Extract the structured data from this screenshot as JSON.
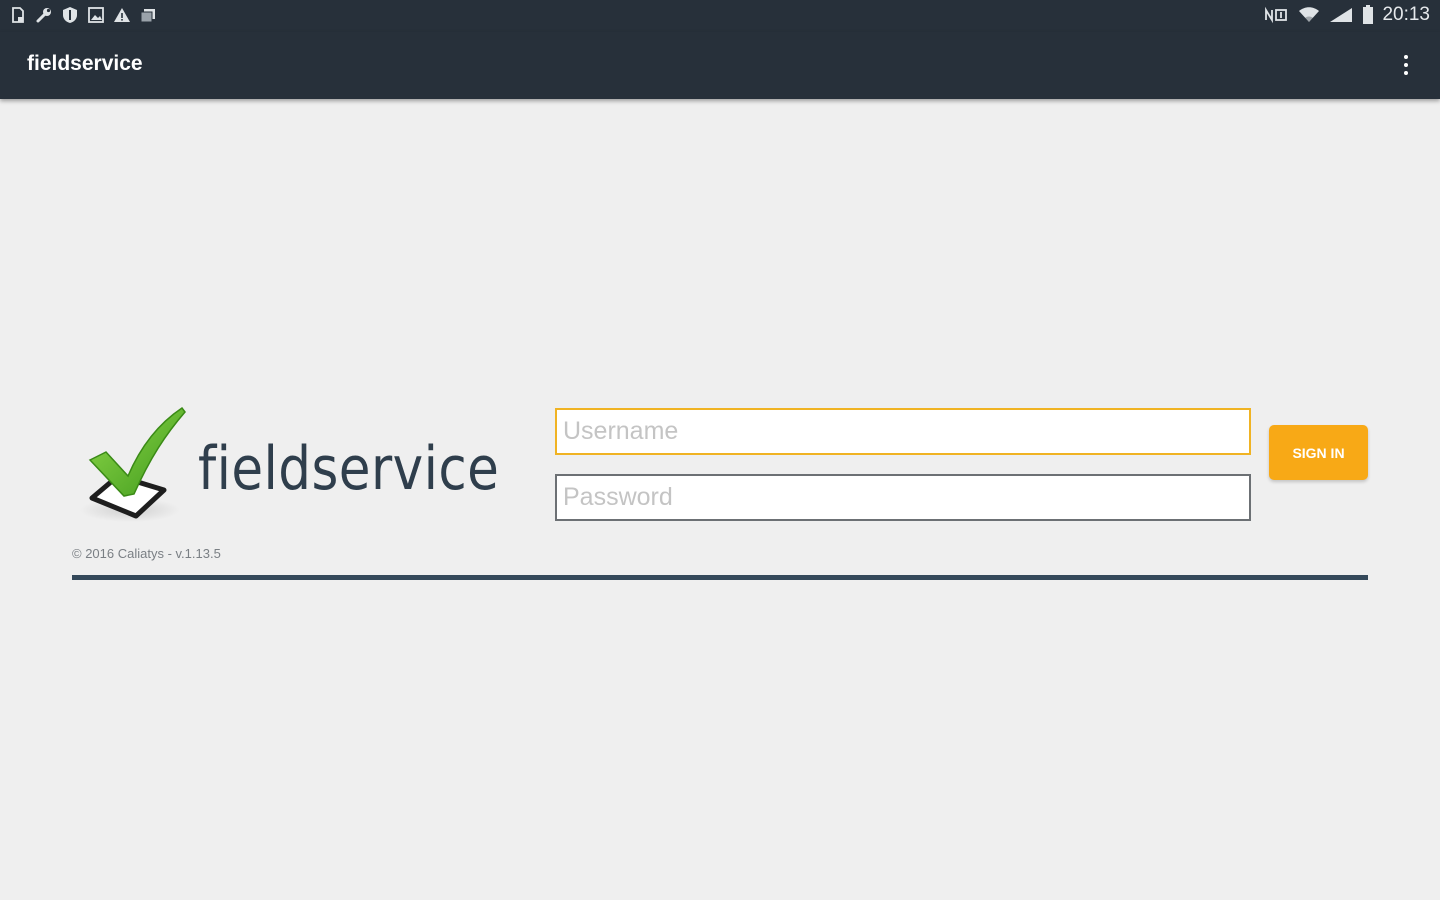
{
  "status_bar": {
    "left_icons": [
      "sd-card-icon",
      "wrench-icon",
      "shield-icon",
      "image-icon",
      "warning-icon",
      "gallery-icon"
    ],
    "right_icons": [
      "nfc-icon",
      "wifi-icon",
      "signal-icon",
      "battery-icon"
    ],
    "time": "20:13"
  },
  "app_bar": {
    "title": "fieldservice",
    "menu_icon": "more-vert-icon"
  },
  "login": {
    "logo_text": "fieldservice",
    "username_placeholder": "Username",
    "username_value": "",
    "password_placeholder": "Password",
    "password_value": "",
    "signin_label": "SIGN IN",
    "copyright": "© 2016 Caliatys - v.1.13.5"
  },
  "colors": {
    "app_bar": "#27303a",
    "background": "#efefef",
    "accent": "#f8a916",
    "focus_border": "#f0b323",
    "logo_text": "#2f3e4c",
    "divider": "#34495a",
    "check_green": "#5ab82a"
  }
}
